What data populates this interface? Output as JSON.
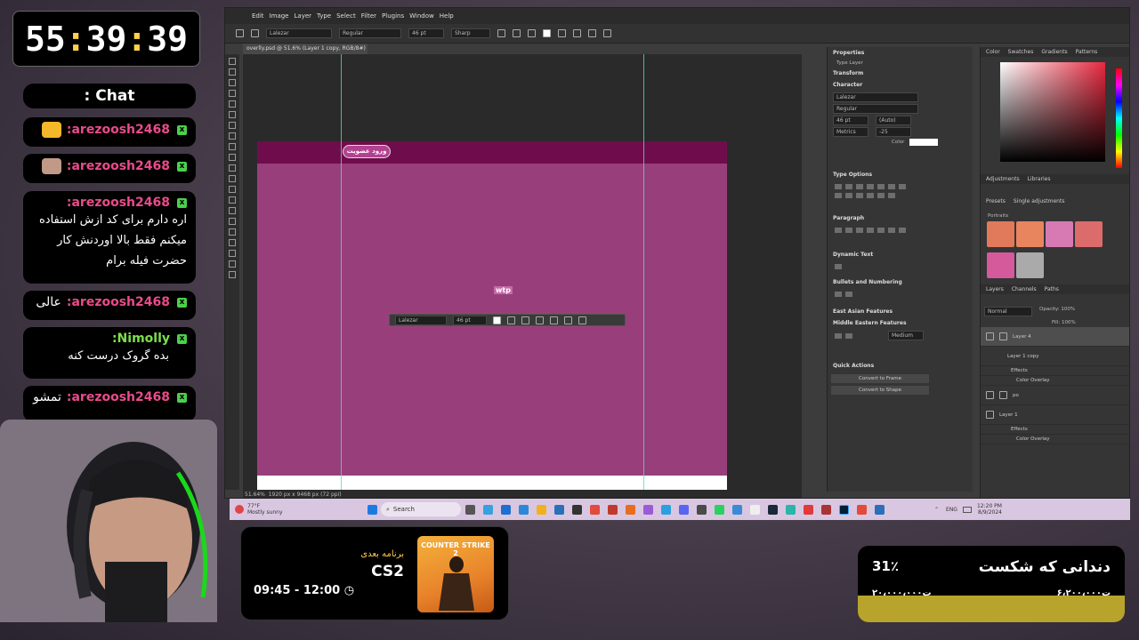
{
  "timer": {
    "hh": "55",
    "mm": "39",
    "ss": "39",
    "sep": ":"
  },
  "chat": {
    "title": ": Chat",
    "messages": [
      {
        "user": ":arezoosh2468",
        "text": ""
      },
      {
        "user": ":arezoosh2468",
        "text": ""
      },
      {
        "user": ":arezoosh2468",
        "text": "اره دارم برای کد ازش استفاده میکنم فقط بالا اوردنش کار حضرت فیله برام"
      },
      {
        "user": ":arezoosh2468",
        "text": "عالی"
      },
      {
        "user": ":Nimolly",
        "text": "بده گروک درست کنه"
      },
      {
        "user": ":arezoosh2468",
        "text": "تمشو"
      }
    ]
  },
  "photoshop": {
    "menu": [
      "Edit",
      "Image",
      "Layer",
      "Type",
      "Select",
      "Filter",
      "Plugins",
      "Window",
      "Help"
    ],
    "options": {
      "font": "Lalezar",
      "style": "Regular",
      "size": "46 pt",
      "aa": "Sharp"
    },
    "doc_tab": "overlly.psd @ 51.6% (Layer 1 copy, RGB/8#) *",
    "status": {
      "zoom": "51.64%",
      "dims": "1920 px x 9468 px (72 ppi)"
    },
    "canvas": {
      "pill_text": "ورود عضویت",
      "wip_text": "wtp"
    },
    "floating": {
      "font": "Lalezar",
      "size": "46 pt"
    },
    "properties": {
      "title": "Properties",
      "type_layer": "Type Layer",
      "transform": "Transform",
      "character": "Character",
      "font": "Lalezar",
      "style": "Regular",
      "size": "46 pt",
      "leading": "(Auto)",
      "kerning": "Metrics",
      "tracking": "-25",
      "color_label": "Color",
      "type_options": "Type Options",
      "paragraph": "Paragraph",
      "dynamic_text": "Dynamic Text",
      "bullets": "Bullets and Numbering",
      "east_asian": "East Asian Features",
      "middle_eastern": "Middle Eastern Features",
      "me_value": "Medium",
      "quick_actions": "Quick Actions",
      "convert_frame": "Convert to Frame",
      "convert_shape": "Convert to Shape"
    },
    "color_tabs": [
      "Color",
      "Swatches",
      "Gradients",
      "Patterns"
    ],
    "adjust_tabs": [
      "Adjustments",
      "Libraries"
    ],
    "adjust_sub": [
      "Presets",
      "Single adjustments"
    ],
    "portraits": "Portraits",
    "layer_tabs": [
      "Layers",
      "Channels",
      "Paths"
    ],
    "blend": "Normal",
    "opacity": "Opacity: 100%",
    "fill": "Fill: 100%",
    "layers": [
      {
        "name": "Layer 4"
      },
      {
        "name": "Layer 1 copy"
      },
      {
        "name": "Effects"
      },
      {
        "name": "Color Overlay"
      },
      {
        "name": "po"
      },
      {
        "name": "Layer 1"
      },
      {
        "name": "Effects"
      },
      {
        "name": "Color Overlay"
      }
    ]
  },
  "taskbar": {
    "weather_temp": "77°F",
    "weather_text": "Mostly sunny",
    "search": "Search",
    "lang": "ENG",
    "time": "12:20 PM",
    "date": "8/9/2024"
  },
  "next_show": {
    "label": "برنامه بعدی",
    "game": "CS2",
    "time": "09:45 - 12:00",
    "cover_text": "COUNTER STRIKE 2"
  },
  "donation": {
    "title": "دندانی که شکست",
    "percent": "31٪",
    "current": "۶،۲۰۰،۰۰۰ت",
    "goal": "۲۰،۰۰۰،۰۰۰ت"
  }
}
